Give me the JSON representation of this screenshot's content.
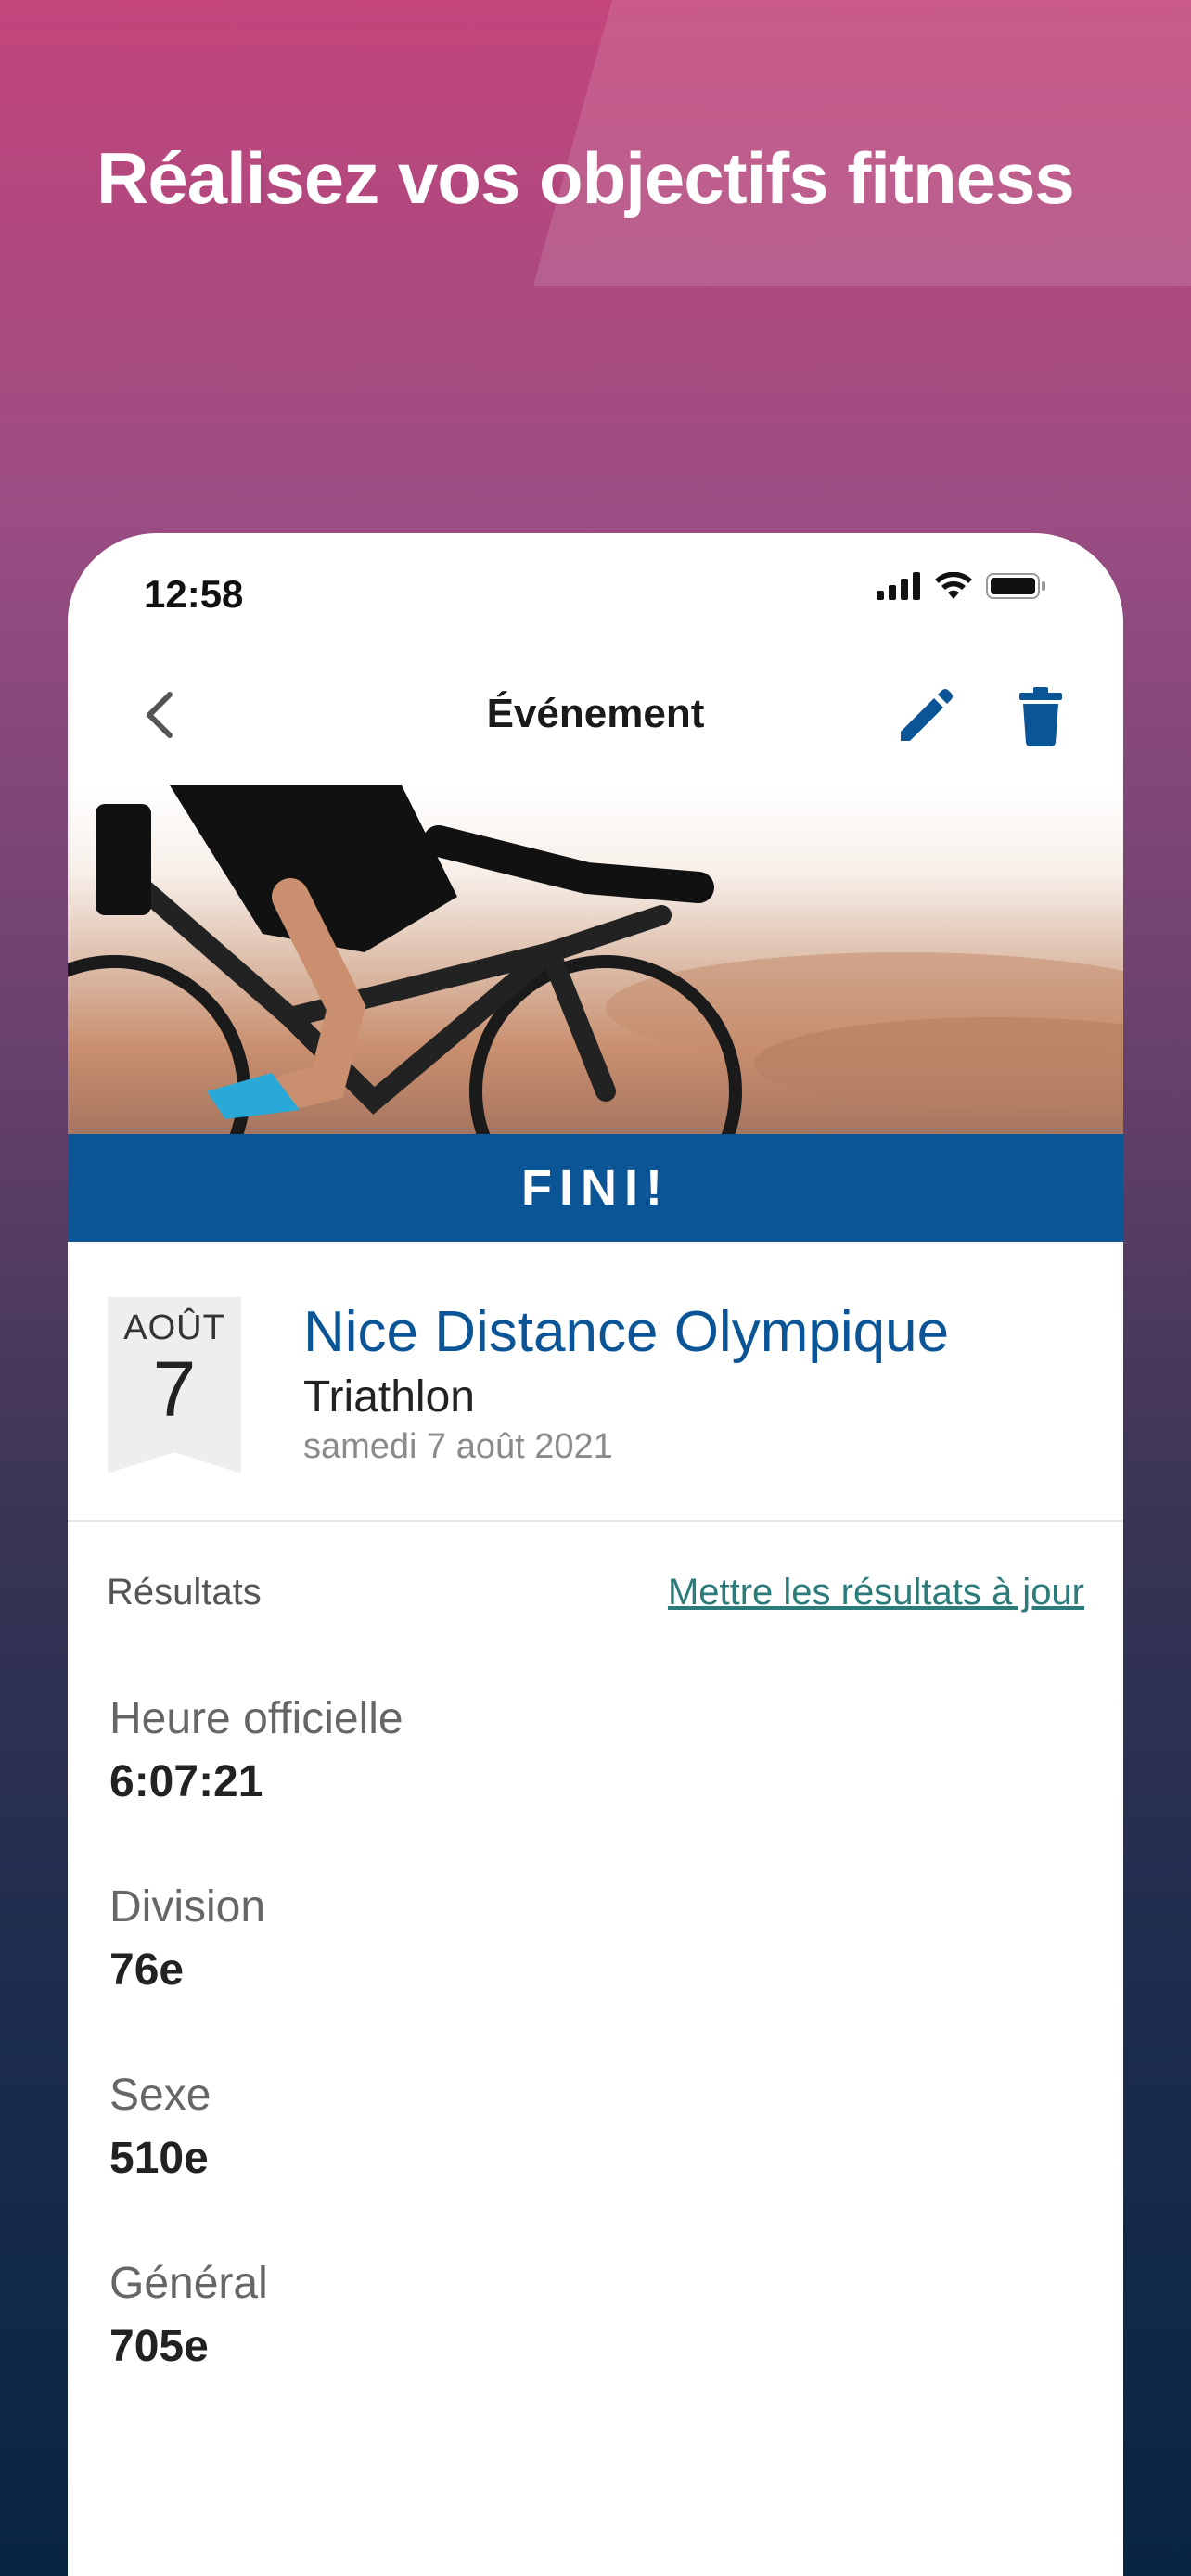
{
  "headline": "Réalisez vos objectifs fitness",
  "status_bar": {
    "time": "12:58"
  },
  "nav": {
    "title": "Événement",
    "back_icon": "chevron-left-icon",
    "edit_icon": "pencil-icon",
    "delete_icon": "trash-icon"
  },
  "banner": {
    "text": "FINI!"
  },
  "event": {
    "month": "AOÛT",
    "day": "7",
    "name": "Nice Distance Olympique",
    "type": "Triathlon",
    "date": "samedi 7 août 2021"
  },
  "results": {
    "label": "Résultats",
    "update_link": "Mettre les résultats à jour",
    "items": [
      {
        "label": "Heure officielle",
        "value": "6:07:21"
      },
      {
        "label": "Division",
        "value": "76e"
      },
      {
        "label": "Sexe",
        "value": "510e"
      },
      {
        "label": "Général",
        "value": "705e"
      }
    ]
  },
  "colors": {
    "accent": "#0b5597",
    "link": "#2c7b7b",
    "gradient_top": "#c3457c",
    "gradient_bottom": "#082541"
  }
}
